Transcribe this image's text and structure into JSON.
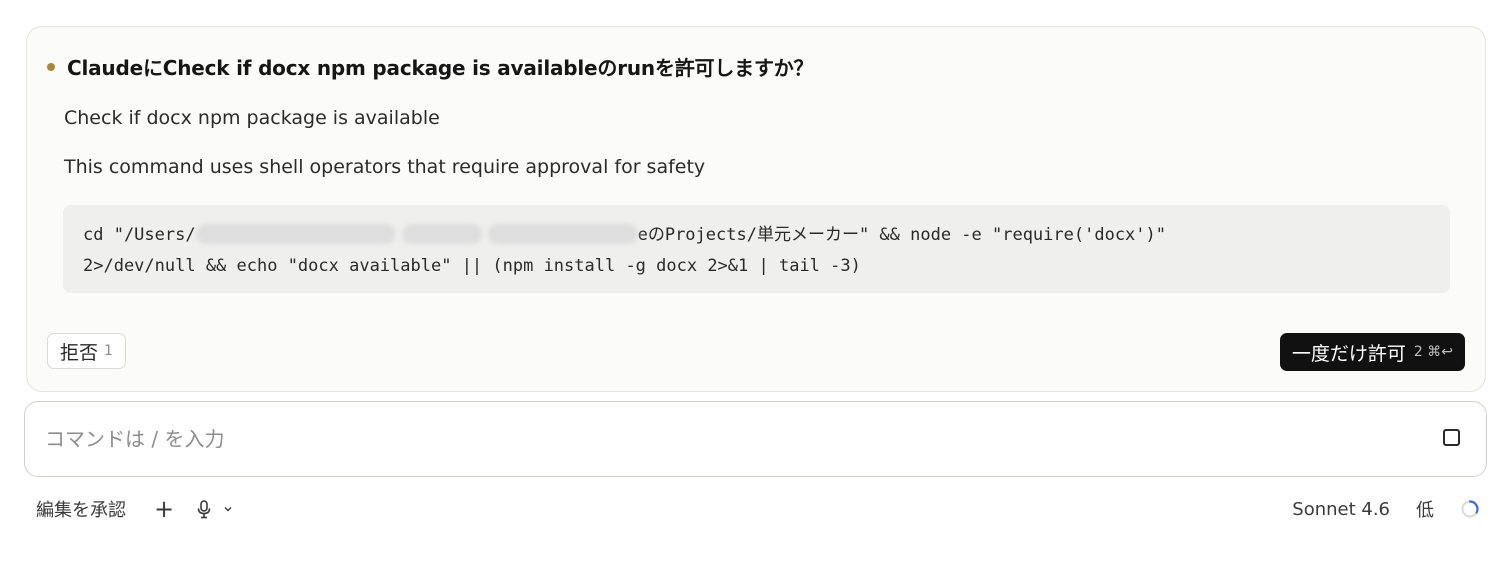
{
  "permission": {
    "title": "ClaudeにCheck if docx npm package is availableのrunを許可しますか？",
    "description": "Check if docx npm package is available",
    "reason": "This command uses shell operators that require approval for safety",
    "command": {
      "line1_prefix": "cd \"/Users/",
      "line1_suffix": "eのProjects/単元メーカー\" && node -e \"require('docx')\"",
      "line2": "2>/dev/null && echo \"docx available\" || (npm install -g docx 2>&1 | tail -3)"
    },
    "reject_label": "拒否",
    "reject_shortcut": "1",
    "allow_label": "一度だけ許可",
    "allow_shortcut": "2 ⌘↩"
  },
  "composer": {
    "placeholder": "コマンドは / を入力"
  },
  "footer": {
    "accept_edits_label": "編集を承認",
    "add_icon_glyph": "+",
    "model_label": "Sonnet 4.6",
    "effort_label": "低"
  },
  "colors": {
    "accent_dot": "#a8873c",
    "allow_button_bg": "#111111",
    "spinner": "#3b6fd8"
  }
}
